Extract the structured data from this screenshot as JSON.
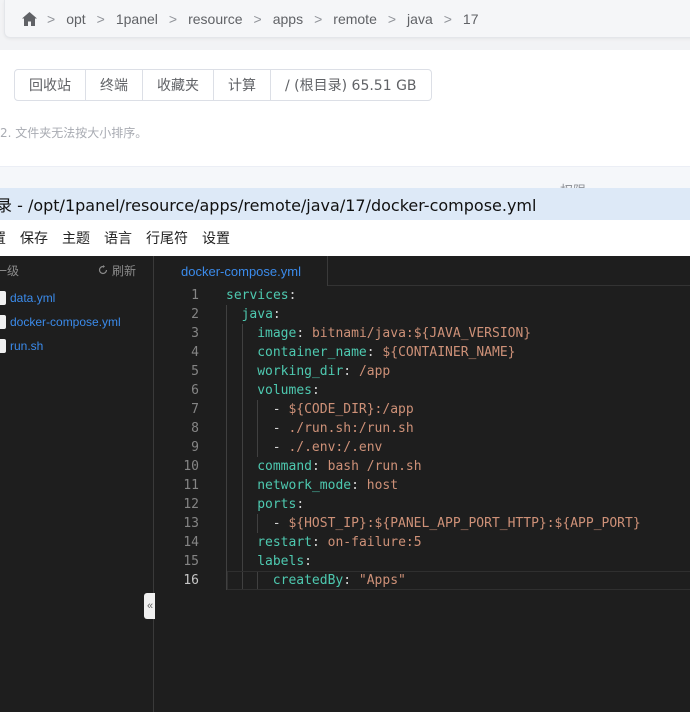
{
  "breadcrumb": [
    "opt",
    "1panel",
    "resource",
    "apps",
    "remote",
    "java",
    "17"
  ],
  "breadcrumb_sep": ">",
  "toolbar_buttons": [
    "回收站",
    "终端",
    "收藏夹",
    "计算",
    "/ (根目录) 65.51 GB"
  ],
  "hint": "2. 文件夹无法按大小排序。",
  "table_column": "权限",
  "editor": {
    "title": "录 - /opt/1panel/resource/apps/remote/java/17/docker-compose.yml",
    "menu": [
      "置",
      "保存",
      "主题",
      "语言",
      "行尾符",
      "设置"
    ],
    "explorer": {
      "up_label": "一级",
      "refresh_label": "刷新",
      "files": [
        "data.yml",
        "docker-compose.yml",
        "run.sh"
      ]
    },
    "tab": "docker-compose.yml",
    "collapse_symbol": "«",
    "lines": [
      {
        "n": "1",
        "indent": 0,
        "key": "services",
        "sep": ":",
        "val": ""
      },
      {
        "n": "2",
        "indent": 1,
        "key": "java",
        "sep": ":",
        "val": ""
      },
      {
        "n": "3",
        "indent": 2,
        "key": "image",
        "sep": ": ",
        "val": "bitnami/java:${JAVA_VERSION}"
      },
      {
        "n": "4",
        "indent": 2,
        "key": "container_name",
        "sep": ": ",
        "val": "${CONTAINER_NAME}"
      },
      {
        "n": "5",
        "indent": 2,
        "key": "working_dir",
        "sep": ": ",
        "val": "/app"
      },
      {
        "n": "6",
        "indent": 2,
        "key": "volumes",
        "sep": ":",
        "val": ""
      },
      {
        "n": "7",
        "indent": 3,
        "key": "",
        "sep": "- ",
        "val": "${CODE_DIR}:/app"
      },
      {
        "n": "8",
        "indent": 3,
        "key": "",
        "sep": "- ",
        "val": "./run.sh:/run.sh"
      },
      {
        "n": "9",
        "indent": 3,
        "key": "",
        "sep": "- ",
        "val": "./.env:/.env"
      },
      {
        "n": "10",
        "indent": 2,
        "key": "command",
        "sep": ": ",
        "val": "bash /run.sh"
      },
      {
        "n": "11",
        "indent": 2,
        "key": "network_mode",
        "sep": ": ",
        "val": "host"
      },
      {
        "n": "12",
        "indent": 2,
        "key": "ports",
        "sep": ":",
        "val": ""
      },
      {
        "n": "13",
        "indent": 3,
        "key": "",
        "sep": "- ",
        "val": "${HOST_IP}:${PANEL_APP_PORT_HTTP}:${APP_PORT}"
      },
      {
        "n": "14",
        "indent": 2,
        "key": "restart",
        "sep": ": ",
        "val": "on-failure:5"
      },
      {
        "n": "15",
        "indent": 2,
        "key": "labels",
        "sep": ":",
        "val": ""
      },
      {
        "n": "16",
        "indent": 3,
        "key": "createdBy",
        "sep": ": ",
        "val": "\"Apps\""
      }
    ],
    "active_line": "16"
  },
  "colors": {
    "editor_bg": "#1e1e1e",
    "yaml_key": "#4ec9b0",
    "yaml_value": "#ce9178",
    "link_blue": "#3b8beb",
    "title_bar": "#dde9f7"
  }
}
